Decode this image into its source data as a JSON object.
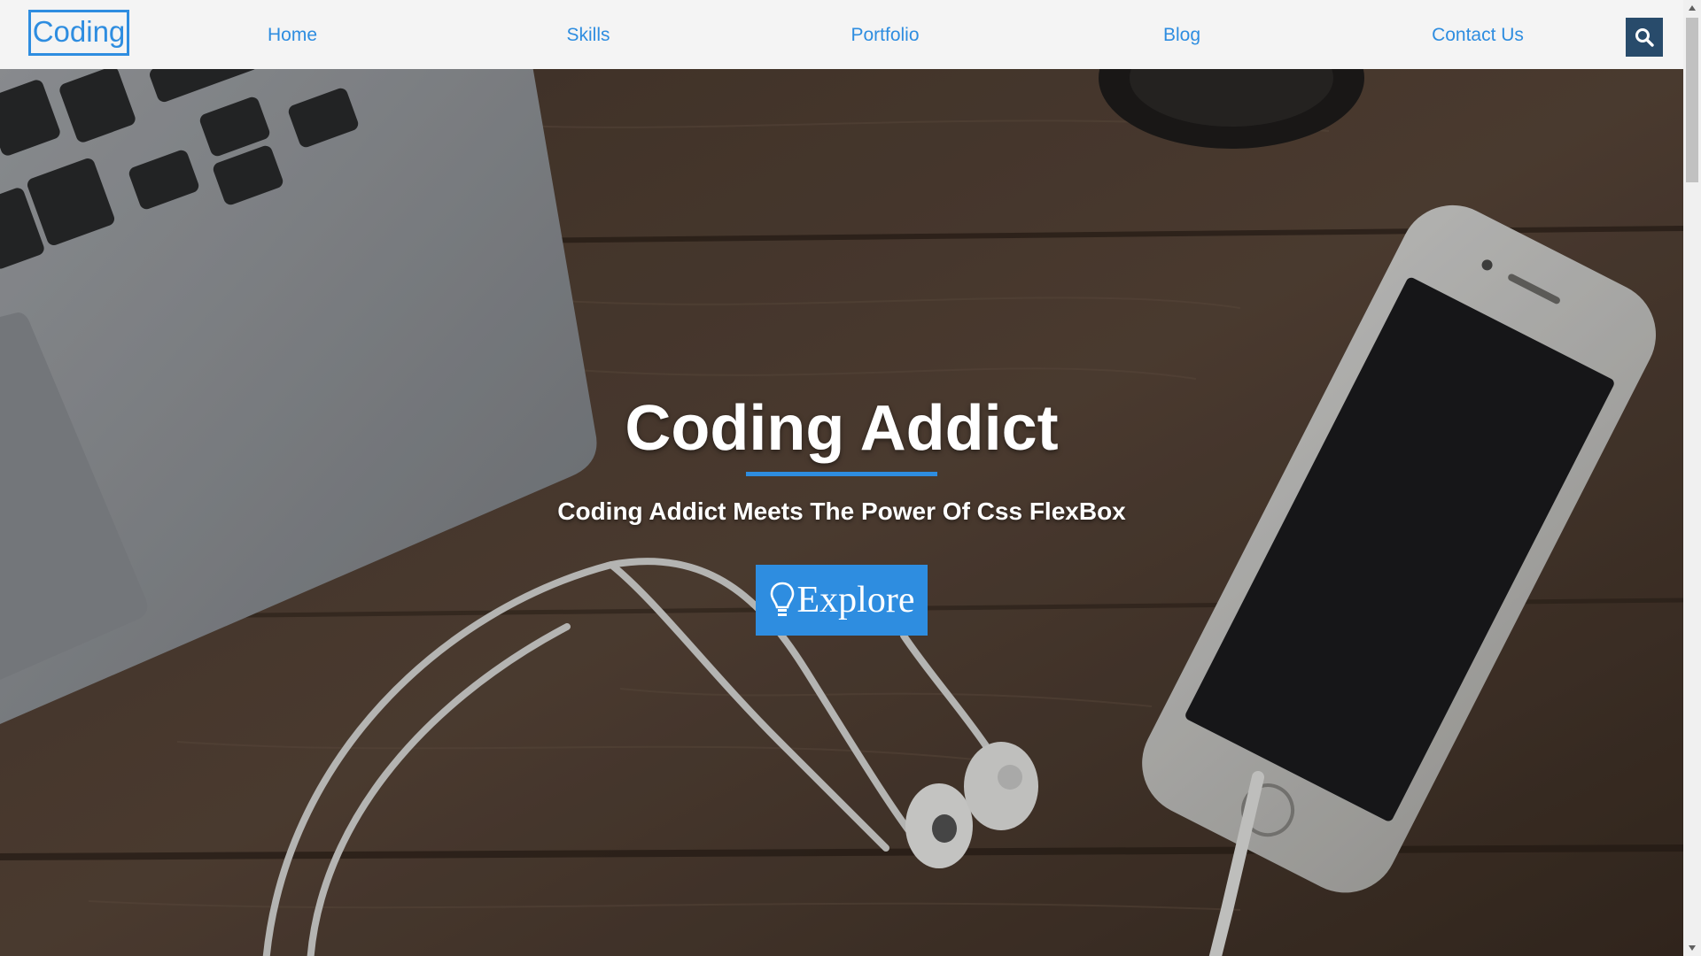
{
  "navbar": {
    "logo": "Coding",
    "items": [
      {
        "label": "Home"
      },
      {
        "label": "Skills"
      },
      {
        "label": "Portfolio"
      },
      {
        "label": "Blog"
      },
      {
        "label": "Contact Us"
      }
    ],
    "search_icon": "search-icon"
  },
  "hero": {
    "title": "Coding Addict",
    "subtitle": "Coding Addict Meets The Power Of Css FlexBox",
    "button_label": "Explore",
    "button_icon": "lightbulb-icon"
  },
  "colors": {
    "accent": "#2e8de0",
    "navbar_bg": "#f4f4f4",
    "search_bg": "#284b6b"
  }
}
